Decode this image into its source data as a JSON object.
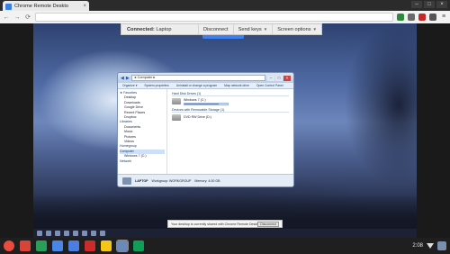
{
  "browser": {
    "tab_title": "Chrome Remote Deskto",
    "tab_close": "×",
    "window_controls": [
      "–",
      "□",
      "×"
    ],
    "nav": {
      "back": "←",
      "forward": "→",
      "reload": "⟳"
    },
    "menu_glyph": "≡",
    "extension_colors": [
      "#2b8a3e",
      "#6a6a6a",
      "#c62828",
      "#555555"
    ]
  },
  "connection_bar": {
    "label": "Connected:",
    "host": "Laptop",
    "buttons": [
      "Disconnect",
      "Send keys",
      "Screen options"
    ]
  },
  "explorer": {
    "path": "▸ Computer ▸",
    "menu": [
      "Organize ▾",
      "System properties",
      "Uninstall or change a program",
      "Map network drive",
      "Open Control Panel"
    ],
    "nav_items": [
      {
        "label": "★ Favorites",
        "cls": "grp"
      },
      {
        "label": "Desktop",
        "cls": "ind"
      },
      {
        "label": "Downloads",
        "cls": "ind"
      },
      {
        "label": "Google Drive",
        "cls": "ind"
      },
      {
        "label": "Recent Places",
        "cls": "ind"
      },
      {
        "label": "Dropbox",
        "cls": "ind"
      },
      {
        "label": "Libraries",
        "cls": "grp"
      },
      {
        "label": "Documents",
        "cls": "ind"
      },
      {
        "label": "Music",
        "cls": "ind"
      },
      {
        "label": "Pictures",
        "cls": "ind"
      },
      {
        "label": "Videos",
        "cls": "ind"
      },
      {
        "label": "Homegroup",
        "cls": "grp"
      },
      {
        "label": "Computer",
        "cls": "grp sel"
      },
      {
        "label": "Windows 7 (C:)",
        "cls": "ind"
      },
      {
        "label": "Network",
        "cls": "grp"
      }
    ],
    "hdd_header": "Hard Disk Drives (1)",
    "drive_c": {
      "name": "Windows 7 (C:)",
      "fill": 0.8
    },
    "removable_header": "Devices with Removable Storage (1)",
    "dvd": {
      "name": "DVD RW Drive (D:)"
    },
    "status": {
      "name": "LAPTOP",
      "workgroup": "Workgroup: WORKGROUP",
      "memory": "Memory: 4.00 GB",
      "processor": "Processor: Intel(R) Core(TM) i5"
    }
  },
  "notification": {
    "message": "Your desktop is currently shared with Chrome Remote Desktop",
    "button": "Disconnect"
  },
  "shelf": {
    "apps": [
      {
        "name": "chrome-icon",
        "color": "#e94b3c",
        "round": true
      },
      {
        "name": "gmail-icon",
        "color": "#d84437"
      },
      {
        "name": "drive-icon",
        "color": "#2a9d5b"
      },
      {
        "name": "search-icon",
        "color": "#4a86e8"
      },
      {
        "name": "docs-icon",
        "color": "#4c7de0"
      },
      {
        "name": "youtube-icon",
        "color": "#cc2b2b"
      },
      {
        "name": "keep-icon",
        "color": "#f5c518"
      },
      {
        "name": "remote-desktop-icon",
        "color": "#6b8ab8",
        "active": true
      },
      {
        "name": "hangouts-icon",
        "color": "#0f9d58"
      }
    ],
    "time": "2:08"
  }
}
